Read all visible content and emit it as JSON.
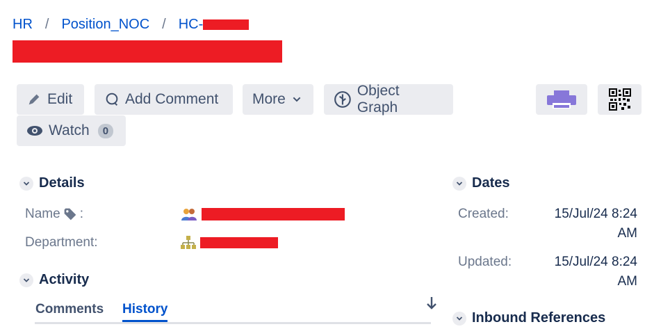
{
  "breadcrumb": {
    "items": [
      "HR",
      "Position_NOC",
      "HC-"
    ],
    "separator": "/"
  },
  "toolbar": {
    "edit_label": "Edit",
    "add_comment_label": "Add Comment",
    "more_label": "More",
    "object_graph_label": "Object Graph",
    "watch_label": "Watch",
    "watch_count": "0"
  },
  "details": {
    "heading": "Details",
    "name_label": "Name",
    "name_suffix": ":",
    "department_label": "Department:"
  },
  "activity": {
    "heading": "Activity",
    "tabs": [
      "Comments",
      "History"
    ],
    "active_tab": "History"
  },
  "dates": {
    "heading": "Dates",
    "created_label": "Created:",
    "created_value": "15/Jul/24 8:24 AM",
    "updated_label": "Updated:",
    "updated_value": "15/Jul/24 8:24 AM"
  },
  "inbound": {
    "heading": "Inbound References"
  },
  "colors": {
    "link": "#0052cc",
    "button_bg": "#ebecf0",
    "printer": "#8777d9",
    "redaction": "#ed1c24"
  }
}
